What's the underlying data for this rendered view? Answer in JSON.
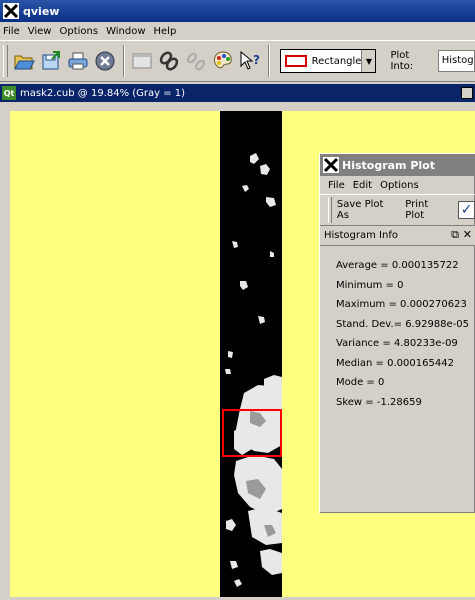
{
  "window": {
    "title": "qview"
  },
  "menubar": {
    "items": [
      "File",
      "View",
      "Options",
      "Window",
      "Help"
    ]
  },
  "toolbar": {
    "buttons": [
      {
        "icon": "open-folder-icon"
      },
      {
        "icon": "save-export-icon"
      },
      {
        "icon": "print-icon"
      },
      {
        "icon": "close-circle-icon"
      },
      {
        "icon": "blank-window-icon"
      },
      {
        "icon": "link-icon"
      },
      {
        "icon": "unlink-icon"
      },
      {
        "icon": "palette-icon"
      },
      {
        "icon": "whats-this-icon"
      }
    ],
    "shape_select": {
      "value": "Rectangle",
      "swatch_color": "#d40000"
    },
    "plot_into_label": "Plot Into:",
    "plot_into_value": "Histogram"
  },
  "subwindow": {
    "title": "mask2.cub @ 19.84% (Gray = 1)",
    "badge": "Qt"
  },
  "viewport": {
    "background": "#ffff80",
    "selection_color": "#ff0000"
  },
  "histogram": {
    "title": "Histogram Plot",
    "menu": [
      "File",
      "Edit",
      "Options"
    ],
    "tools": {
      "save": "Save Plot As",
      "print": "Print Plot"
    },
    "info_title": "Histogram Info",
    "stats": [
      {
        "label": "Average",
        "value": "0.000135722"
      },
      {
        "label": "Minimum",
        "value": "0"
      },
      {
        "label": "Maximum",
        "value": "0.000270623"
      },
      {
        "label": "Stand. Dev.",
        "value": "6.92988e-05"
      },
      {
        "label": "Variance",
        "value": "4.80233e-09"
      },
      {
        "label": "Median",
        "value": "0.000165442"
      },
      {
        "label": "Mode",
        "value": "0"
      },
      {
        "label": "Skew",
        "value": "-1.28659"
      }
    ]
  }
}
